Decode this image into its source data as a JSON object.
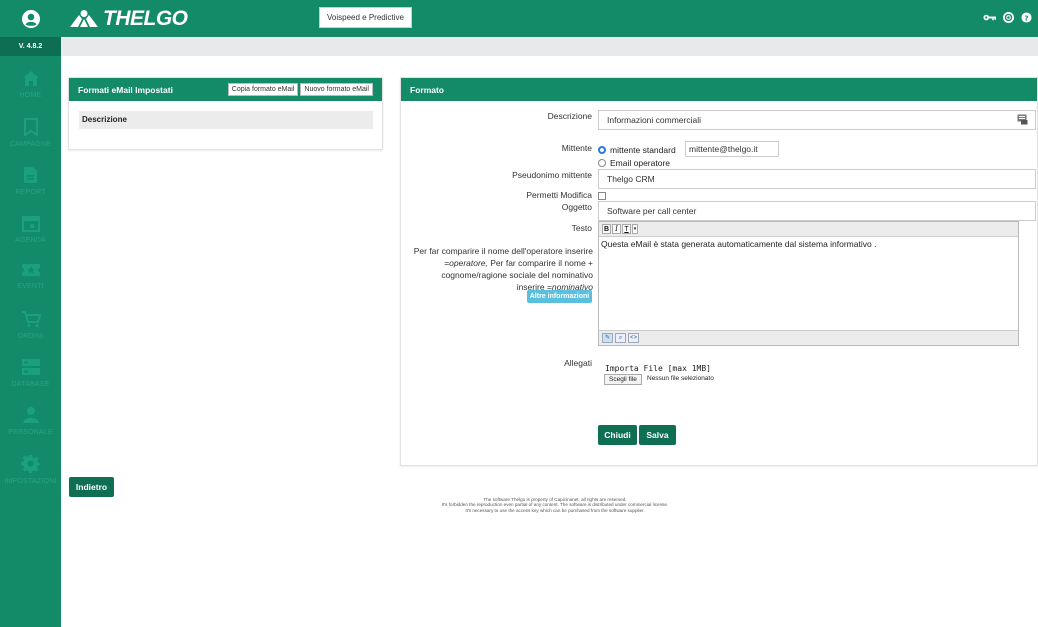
{
  "app": {
    "logo_text": "THELGO",
    "version": "V. 4.8.2",
    "top_button": "Voispeed e Predictive"
  },
  "sidebar": {
    "items": [
      {
        "label": "HOME",
        "icon": "home-icon"
      },
      {
        "label": "CAMPAGNE",
        "icon": "campaign-icon"
      },
      {
        "label": "REPORT",
        "icon": "report-icon"
      },
      {
        "label": "AGENDA",
        "icon": "calendar-icon"
      },
      {
        "label": "EVENTI",
        "icon": "ticket-icon"
      },
      {
        "label": "ORDINI",
        "icon": "cart-icon"
      },
      {
        "label": "DATABASE",
        "icon": "database-icon"
      },
      {
        "label": "PERSONALE",
        "icon": "person-icon"
      },
      {
        "label": "IMPOSTAZIONI",
        "icon": "gear-icon"
      }
    ]
  },
  "left_panel": {
    "title": "Formati eMail Impostati",
    "copy_button": "Copia formato eMail",
    "new_button": "Nuovo formato eMail",
    "column_header": "Descrizione",
    "back_button": "Indietro"
  },
  "form": {
    "title": "Formato",
    "descrizione_label": "Descrizione",
    "descrizione_value": "Informazioni commerciali",
    "mittente_label": "Mittente",
    "mittente_option1": "mittente standard",
    "mittente_email": "mittente@thelgo.it",
    "mittente_option2": "Email operatore",
    "pseudonimo_label": "Pseudonimo mittente",
    "pseudonimo_value": "Thelgo CRM",
    "permetti_label": "Permetti Modifica",
    "oggetto_label": "Oggetto",
    "oggetto_value": "Software per call center",
    "testo_label": "Testo",
    "help_line1": "Per far comparire il nome dell'operatore inserire",
    "help_op": "=operatore,",
    "help_line2": " Per far comparire il nome +",
    "help_line3": "cognome/ragione sociale del nominativo",
    "help_line4": "inserire ",
    "help_nom": "=nominativo",
    "more_info": "Altre informazioni",
    "body_text": "Questa eMail è stata generata automaticamente dal sistema informativo .",
    "allegati_label": "Allegati",
    "import_label": "Importa File [max 1MB]",
    "choose_file": "Scegli file",
    "no_file": "Nessun file selezionato",
    "close_button": "Chiudi",
    "save_button": "Salva"
  },
  "footer": {
    "line1": "The software Thelgo is property of Capicinanet, all rights are reserved.",
    "line2": "It's forbidden the reproduction even partial of any content. The software is distributed under commercial license.",
    "line3": "It's necessary to use the access key which can be purchased from the software supplier."
  },
  "colors": {
    "primary": "#138a68",
    "dark": "#0f6f54",
    "info": "#5bc0de"
  }
}
